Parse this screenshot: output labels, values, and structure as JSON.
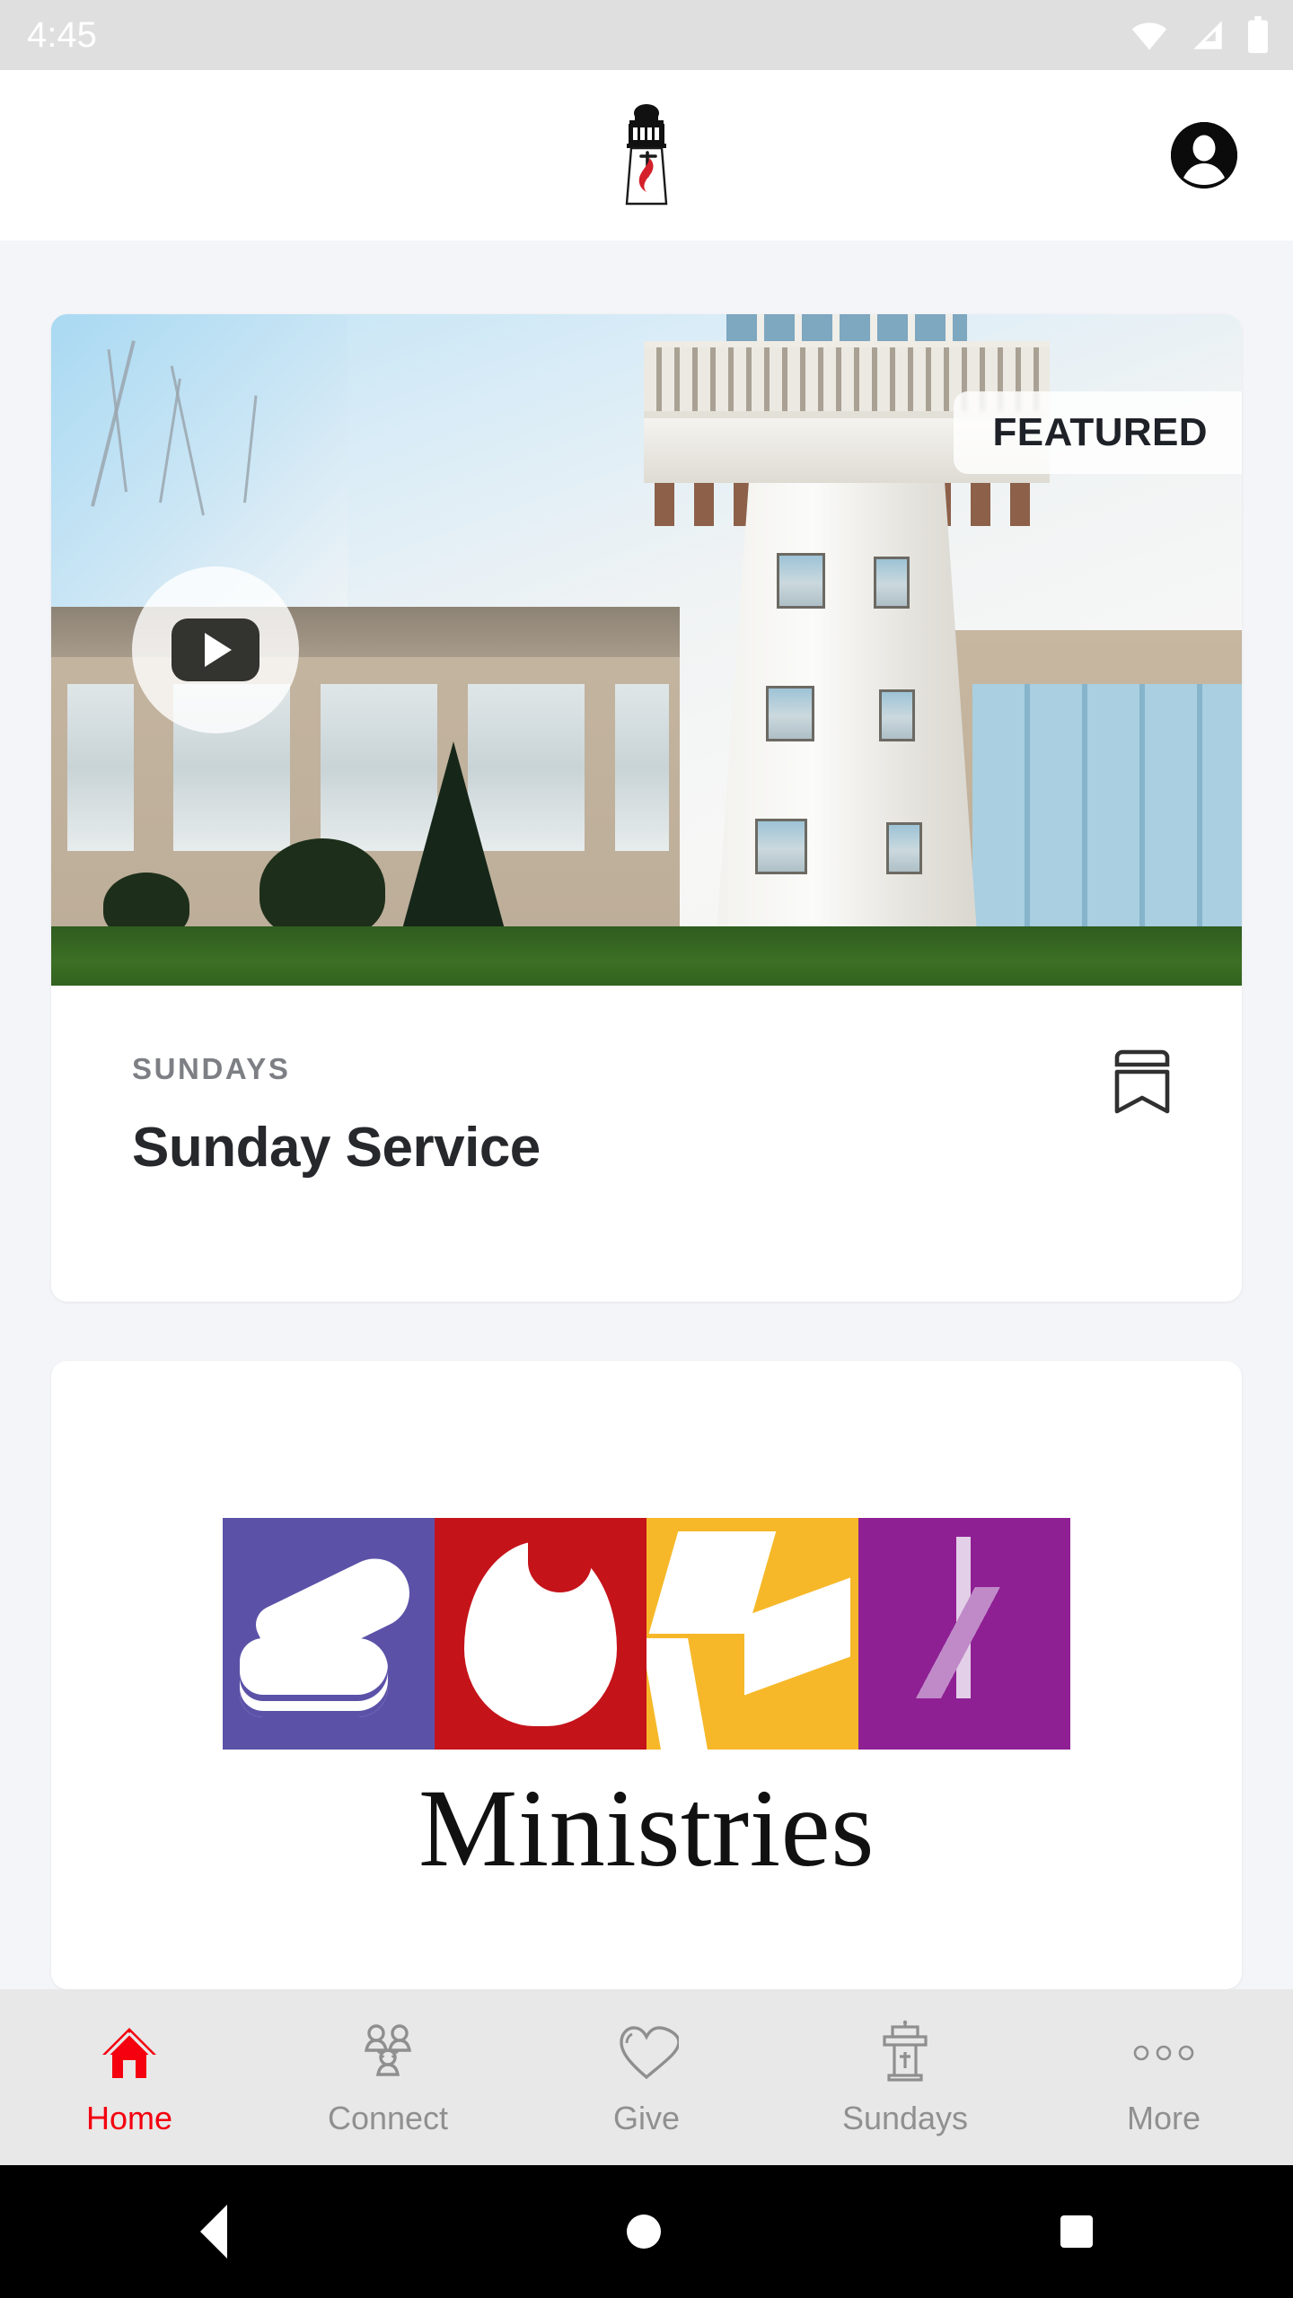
{
  "status_bar": {
    "time": "4:45",
    "icons": [
      "wifi-icon",
      "cellular-signal-icon",
      "battery-icon"
    ]
  },
  "header": {
    "logo_name": "lighthouse-cross-flame-logo",
    "avatar_name": "account-avatar"
  },
  "featured_card": {
    "badge": "FEATURED",
    "eyebrow": "SUNDAYS",
    "title": "Sunday Service",
    "play_label": "play-video",
    "bookmark_label": "bookmark"
  },
  "ministries_card": {
    "word": "Ministries",
    "panels": [
      {
        "name": "hands-panel",
        "color": "#5b52a8"
      },
      {
        "name": "heart-panel",
        "color": "#c5131a"
      },
      {
        "name": "dove-panel",
        "color": "#f6b829"
      },
      {
        "name": "cross-panel",
        "color": "#8e2094"
      }
    ]
  },
  "tab_bar": {
    "active_color": "#f4000f",
    "inactive_color": "#909090",
    "items": [
      {
        "label": "Home",
        "icon": "home-icon",
        "active": true
      },
      {
        "label": "Connect",
        "icon": "people-icon",
        "active": false
      },
      {
        "label": "Give",
        "icon": "heart-icon",
        "active": false
      },
      {
        "label": "Sundays",
        "icon": "lighthouse-icon",
        "active": false
      },
      {
        "label": "More",
        "icon": "more-dots-icon",
        "active": false
      }
    ]
  },
  "system_nav": {
    "back": "back-button",
    "home": "home-button",
    "recents": "recents-button"
  }
}
